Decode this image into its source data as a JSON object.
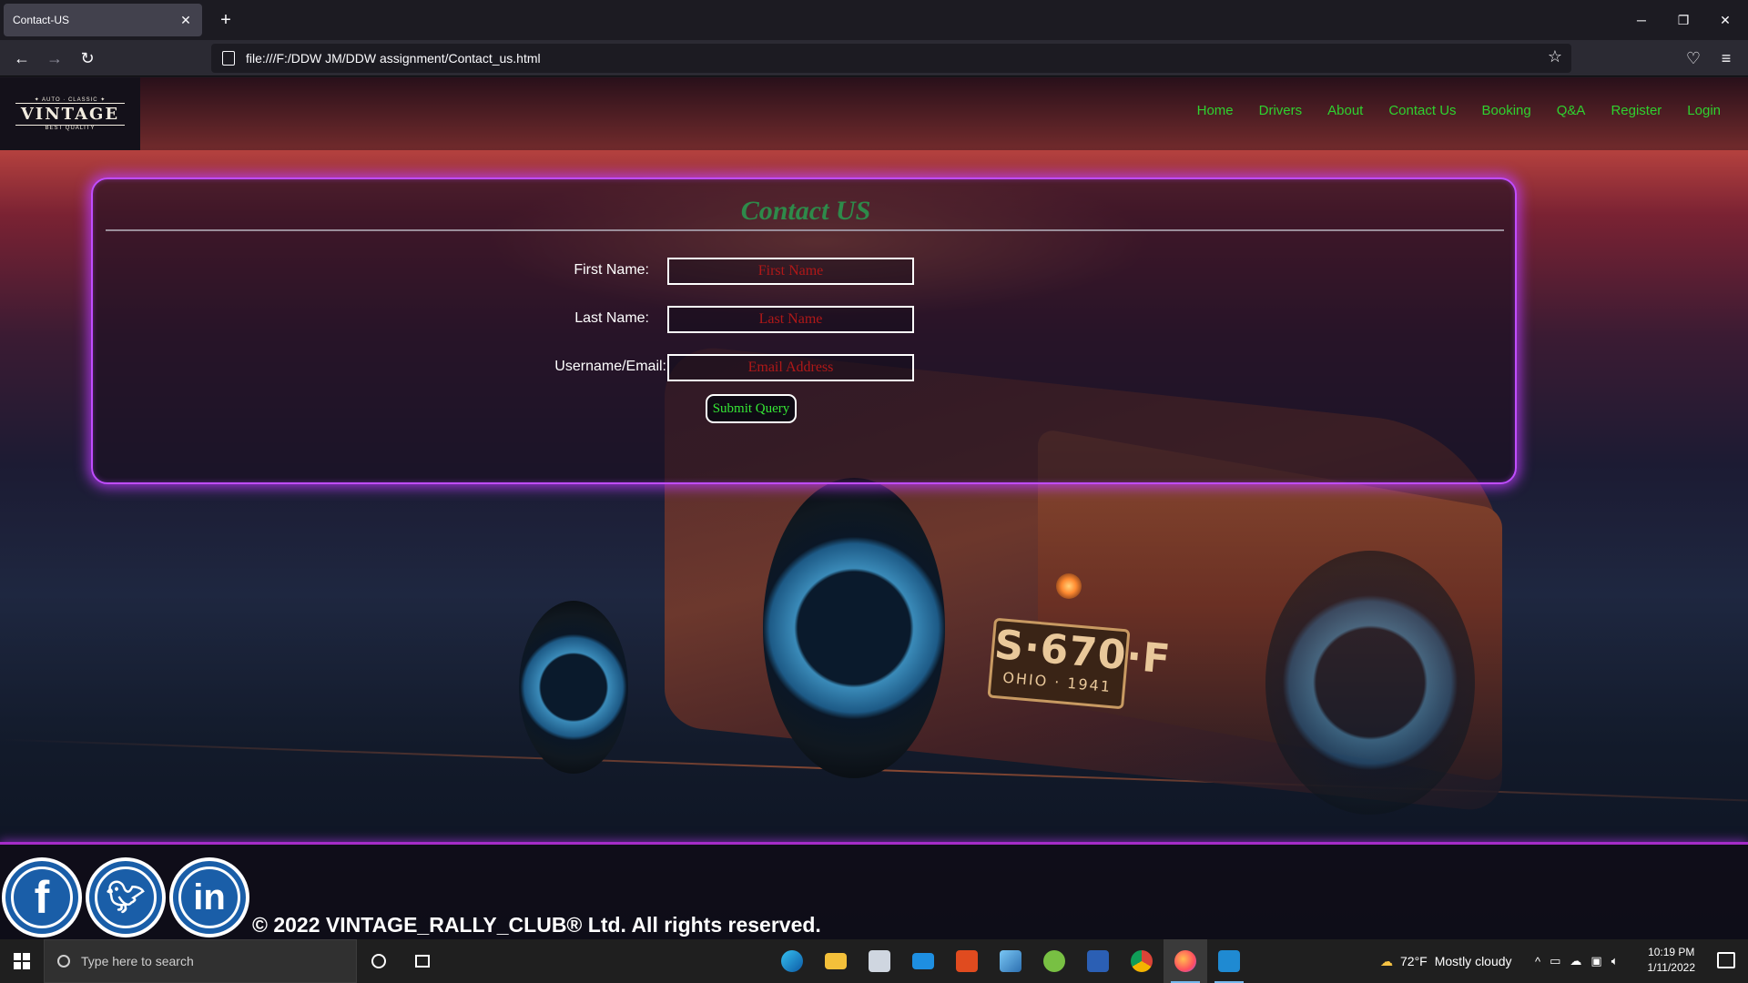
{
  "browser": {
    "tab_title": "Contact-US",
    "tab_close": "✕",
    "new_tab": "+",
    "url": "file:///F:/DDW JM/DDW assignment/Contact_us.html",
    "window_controls": {
      "minimize": "─",
      "restore": "❐",
      "close": "✕"
    }
  },
  "site": {
    "logo": {
      "top": "✦ AUTO · CLASSIC ✦",
      "word": "VINTAGE",
      "bottom": "BEST QUALITY"
    },
    "nav": [
      "Home",
      "Drivers",
      "About",
      "Contact Us",
      "Booking",
      "Q&A",
      "Register",
      "Login"
    ],
    "nav_color": "#2fd12f"
  },
  "background": {
    "license_plate": {
      "number": "S·670·F",
      "state": "OHIO · 1941"
    }
  },
  "contact": {
    "title": "Contact US",
    "fields": [
      {
        "label": "First Name:",
        "placeholder": "First Name",
        "value": ""
      },
      {
        "label": "Last Name:",
        "placeholder": "Last Name",
        "value": ""
      },
      {
        "label": "Username/Email:",
        "placeholder": "Email Address",
        "value": ""
      }
    ],
    "submit_label": "Submit Query",
    "accent_color": "#c04dff"
  },
  "footer": {
    "social": [
      "facebook",
      "twitter",
      "linkedin"
    ],
    "copyright": "© 2022 VINTAGE_RALLY_CLUB® Ltd. All rights reserved."
  },
  "taskbar": {
    "search_placeholder": "Type here to search",
    "weather": {
      "temp": "72°F",
      "condition": "Mostly cloudy"
    },
    "time": "10:19 PM",
    "date": "1/11/2022"
  }
}
